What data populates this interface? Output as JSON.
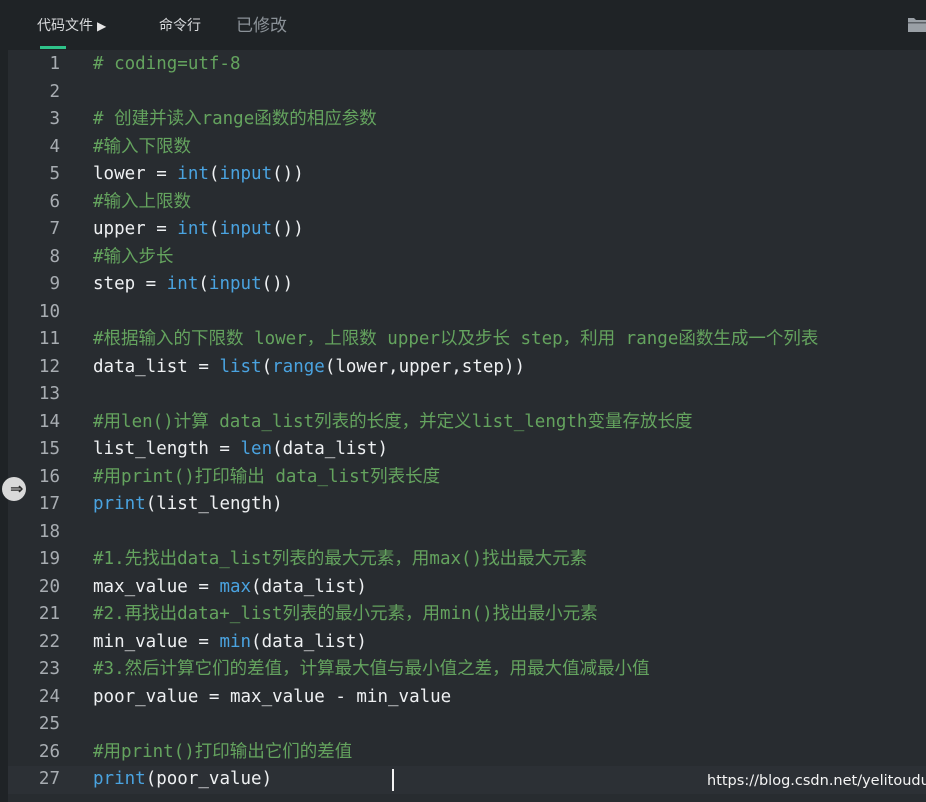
{
  "tabs": {
    "code_file": "代码文件",
    "command_line": "命令行"
  },
  "status": {
    "modified": "已修改"
  },
  "icons": {
    "run": "triangle-right",
    "folder": "folder-icon",
    "fold": "arrow-right-icon"
  },
  "colors": {
    "comment": "#64a35e",
    "builtin": "#4aa3e0",
    "text": "#eef0f2",
    "accent": "#2fc38a"
  },
  "editor": {
    "lines": [
      {
        "num": "1",
        "tokens": [
          {
            "t": "# coding=utf-8",
            "c": "cm"
          }
        ]
      },
      {
        "num": "2",
        "tokens": []
      },
      {
        "num": "3",
        "tokens": [
          {
            "t": "# 创建并读入range函数的相应参数",
            "c": "cm"
          }
        ]
      },
      {
        "num": "4",
        "tokens": [
          {
            "t": "#输入下限数",
            "c": "cm"
          }
        ]
      },
      {
        "num": "5",
        "tokens": [
          {
            "t": "lower = ",
            "c": "tx"
          },
          {
            "t": "int",
            "c": "bi"
          },
          {
            "t": "(",
            "c": "tx"
          },
          {
            "t": "input",
            "c": "bi"
          },
          {
            "t": "())",
            "c": "tx"
          }
        ]
      },
      {
        "num": "6",
        "tokens": [
          {
            "t": "#输入上限数",
            "c": "cm"
          }
        ]
      },
      {
        "num": "7",
        "tokens": [
          {
            "t": "upper = ",
            "c": "tx"
          },
          {
            "t": "int",
            "c": "bi"
          },
          {
            "t": "(",
            "c": "tx"
          },
          {
            "t": "input",
            "c": "bi"
          },
          {
            "t": "())",
            "c": "tx"
          }
        ]
      },
      {
        "num": "8",
        "tokens": [
          {
            "t": "#输入步长",
            "c": "cm"
          }
        ]
      },
      {
        "num": "9",
        "tokens": [
          {
            "t": "step = ",
            "c": "tx"
          },
          {
            "t": "int",
            "c": "bi"
          },
          {
            "t": "(",
            "c": "tx"
          },
          {
            "t": "input",
            "c": "bi"
          },
          {
            "t": "())",
            "c": "tx"
          }
        ]
      },
      {
        "num": "10",
        "tokens": []
      },
      {
        "num": "11",
        "tokens": [
          {
            "t": "#根据输入的下限数 lower，上限数 upper以及步长 step，利用 range函数生成一个列表",
            "c": "cm"
          }
        ]
      },
      {
        "num": "12",
        "tokens": [
          {
            "t": "data_list = ",
            "c": "tx"
          },
          {
            "t": "list",
            "c": "bi"
          },
          {
            "t": "(",
            "c": "tx"
          },
          {
            "t": "range",
            "c": "bi"
          },
          {
            "t": "(lower,upper,step))",
            "c": "tx"
          }
        ]
      },
      {
        "num": "13",
        "tokens": []
      },
      {
        "num": "14",
        "tokens": [
          {
            "t": "#用len()计算 data_list列表的长度，并定义list_length变量存放长度",
            "c": "cm"
          }
        ]
      },
      {
        "num": "15",
        "tokens": [
          {
            "t": "list_length = ",
            "c": "tx"
          },
          {
            "t": "len",
            "c": "bi"
          },
          {
            "t": "(data_list)",
            "c": "tx"
          }
        ]
      },
      {
        "num": "16",
        "tokens": [
          {
            "t": "#用print()打印输出 data_list列表长度",
            "c": "cm"
          }
        ]
      },
      {
        "num": "17",
        "tokens": [
          {
            "t": "print",
            "c": "bi"
          },
          {
            "t": "(list_length)",
            "c": "tx"
          }
        ]
      },
      {
        "num": "18",
        "tokens": []
      },
      {
        "num": "19",
        "tokens": [
          {
            "t": "#1.先找出data_list列表的最大元素，用max()找出最大元素",
            "c": "cm"
          }
        ]
      },
      {
        "num": "20",
        "tokens": [
          {
            "t": "max_value = ",
            "c": "tx"
          },
          {
            "t": "max",
            "c": "bi"
          },
          {
            "t": "(data_list)",
            "c": "tx"
          }
        ]
      },
      {
        "num": "21",
        "tokens": [
          {
            "t": "#2.再找出data+_list列表的最小元素，用min()找出最小元素",
            "c": "cm"
          }
        ]
      },
      {
        "num": "22",
        "tokens": [
          {
            "t": "min_value = ",
            "c": "tx"
          },
          {
            "t": "min",
            "c": "bi"
          },
          {
            "t": "(data_list)",
            "c": "tx"
          }
        ]
      },
      {
        "num": "23",
        "tokens": [
          {
            "t": "#3.然后计算它们的差值，计算最大值与最小值之差，用最大值减最小值",
            "c": "cm"
          }
        ]
      },
      {
        "num": "24",
        "tokens": [
          {
            "t": "poor_value = max_value - min_value",
            "c": "tx"
          }
        ]
      },
      {
        "num": "25",
        "tokens": []
      },
      {
        "num": "26",
        "tokens": [
          {
            "t": "#用print()打印输出它们的差值",
            "c": "cm"
          }
        ]
      },
      {
        "num": "27",
        "tokens": [
          {
            "t": "print",
            "c": "bi"
          },
          {
            "t": "(poor_value)",
            "c": "tx"
          }
        ]
      }
    ]
  },
  "watermark": "https://blog.csdn.net/yelitoudu"
}
